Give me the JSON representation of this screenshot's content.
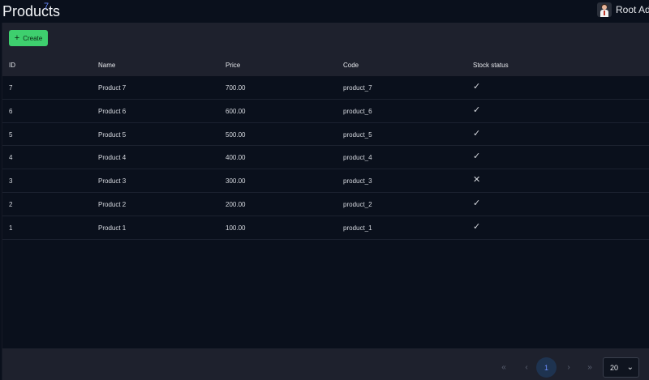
{
  "header": {
    "title": "Products",
    "count": "7",
    "user_name": "Root Admin"
  },
  "toolbar": {
    "create_label": "Create"
  },
  "table": {
    "columns": [
      "ID",
      "Name",
      "Price",
      "Code",
      "Stock status"
    ],
    "rows": [
      {
        "id": "7",
        "name": "Product 7",
        "price": "700.00",
        "code": "product_7",
        "in_stock": true
      },
      {
        "id": "6",
        "name": "Product 6",
        "price": "600.00",
        "code": "product_6",
        "in_stock": true
      },
      {
        "id": "5",
        "name": "Product 5",
        "price": "500.00",
        "code": "product_5",
        "in_stock": true
      },
      {
        "id": "4",
        "name": "Product 4",
        "price": "400.00",
        "code": "product_4",
        "in_stock": true
      },
      {
        "id": "3",
        "name": "Product 3",
        "price": "300.00",
        "code": "product_3",
        "in_stock": false
      },
      {
        "id": "2",
        "name": "Product 2",
        "price": "200.00",
        "code": "product_2",
        "in_stock": true
      },
      {
        "id": "1",
        "name": "Product 1",
        "price": "100.00",
        "code": "product_1",
        "in_stock": true
      }
    ]
  },
  "pagination": {
    "current_page": "1",
    "page_size": "20"
  },
  "icons": {
    "in_stock": "check-icon",
    "out_of_stock": "cross-icon"
  },
  "colors": {
    "accent_green": "#3ecf6e",
    "error_red": "#e5483b",
    "accent_blue": "#6b8cff"
  }
}
